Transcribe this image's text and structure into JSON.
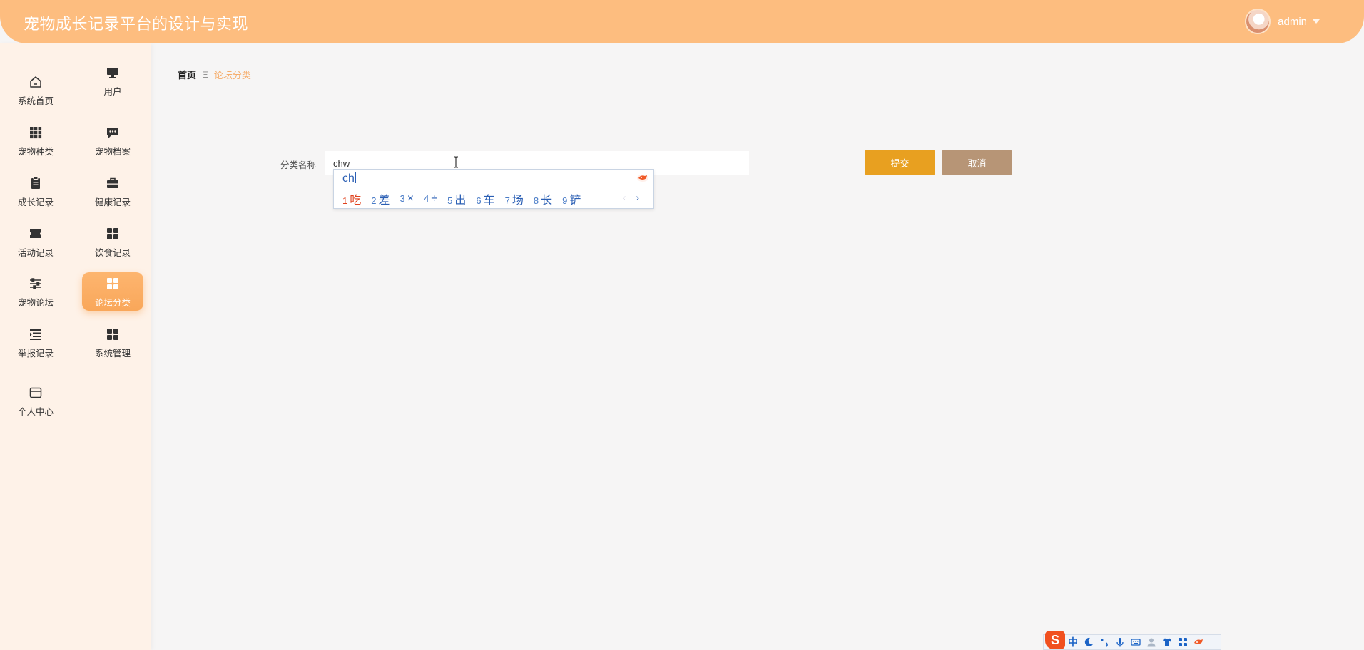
{
  "app": {
    "title": "宠物成长记录平台的设计与实现"
  },
  "user": {
    "name": "admin"
  },
  "sidebar": {
    "items": [
      {
        "label": "系统首页",
        "icon": "home-icon"
      },
      {
        "label": "用户",
        "icon": "monitor-icon"
      },
      {
        "label": "宠物种类",
        "icon": "grid-icon"
      },
      {
        "label": "宠物档案",
        "icon": "chat-icon"
      },
      {
        "label": "成长记录",
        "icon": "clipboard-icon"
      },
      {
        "label": "健康记录",
        "icon": "briefcase-icon"
      },
      {
        "label": "活动记录",
        "icon": "ticket-icon"
      },
      {
        "label": "饮食记录",
        "icon": "grid-icon"
      },
      {
        "label": "宠物论坛",
        "icon": "sliders-icon"
      },
      {
        "label": "论坛分类",
        "icon": "grid-icon"
      },
      {
        "label": "举报记录",
        "icon": "list-icon"
      },
      {
        "label": "系统管理",
        "icon": "grid-icon"
      },
      {
        "label": "个人中心",
        "icon": "card-icon"
      }
    ],
    "active_index": 9,
    "active_color": "#f9a75a"
  },
  "breadcrumb": {
    "home": "首页",
    "separator": "Ξ",
    "current": "论坛分类"
  },
  "form": {
    "label": "分类名称",
    "value": "chw",
    "submit_label": "提交",
    "cancel_label": "取消"
  },
  "ime": {
    "composition": "ch",
    "candidates": [
      {
        "num": "1",
        "text": "吃"
      },
      {
        "num": "2",
        "text": "差"
      },
      {
        "num": "3",
        "text": "×"
      },
      {
        "num": "4",
        "text": "÷"
      },
      {
        "num": "5",
        "text": "出"
      },
      {
        "num": "6",
        "text": "车"
      },
      {
        "num": "7",
        "text": "场"
      },
      {
        "num": "8",
        "text": "长"
      },
      {
        "num": "9",
        "text": "铲"
      }
    ],
    "prev": "‹",
    "next": "›",
    "toolbar": {
      "logo": "S",
      "mode": "中"
    }
  },
  "colors": {
    "header": "#fdbd7f",
    "sidebar": "#fef2e8",
    "submit": "#e8a020",
    "cancel": "#b79576",
    "breadcrumb_current": "#f6ad6b"
  }
}
